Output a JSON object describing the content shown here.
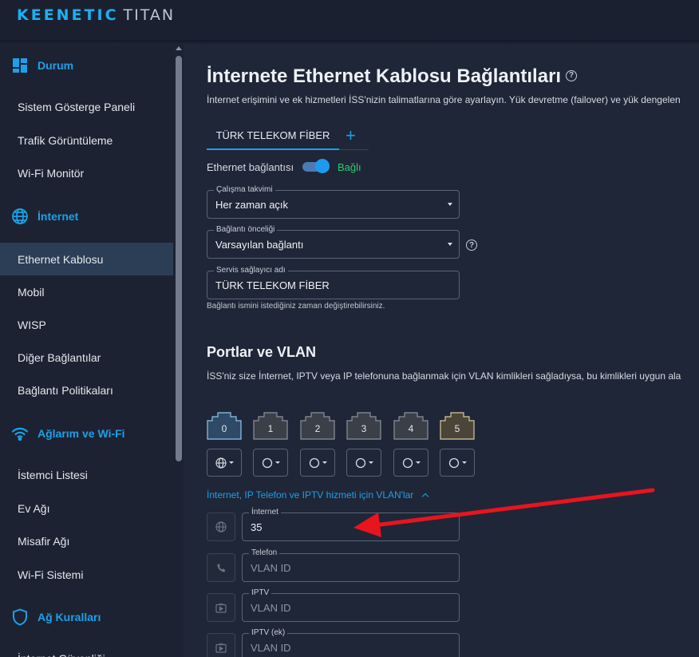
{
  "header": {
    "brand": "KEENETIC",
    "model": "TITAN"
  },
  "sidebar": {
    "sections": [
      {
        "label": "Durum",
        "icon": "dashboard-icon"
      },
      {
        "label": "İnternet",
        "icon": "globe-icon"
      },
      {
        "label": "Ağlarım ve Wi-Fi",
        "icon": "wifi-icon"
      },
      {
        "label": "Ağ Kuralları",
        "icon": "shield-icon"
      }
    ],
    "items": [
      "Sistem Gösterge Paneli",
      "Trafik Görüntüleme",
      "Wi-Fi Monitör",
      "Ethernet Kablosu",
      "Mobil",
      "WISP",
      "Diğer Bağlantılar",
      "Bağlantı Politikaları",
      "İstemci Listesi",
      "Ev Ağı",
      "Misafir Ağı",
      "Wi-Fi Sistemi",
      "İnternet Güvenliği"
    ],
    "active_item": "Ethernet Kablosu"
  },
  "main": {
    "title": "İnternete Ethernet Kablosu Bağlantıları",
    "description": "İnternet erişimini ve ek hizmetleri İSS'nizin talimatlarına göre ayarlayın. Yük devretme (failover) ve yük dengelen",
    "tab": "TÜRK TELEKOM FİBER",
    "toggle": {
      "label": "Ethernet bağlantısı",
      "status": "Bağlı",
      "on": true
    },
    "fields": {
      "schedule": {
        "label": "Çalışma takvimi",
        "value": "Her zaman açık"
      },
      "priority": {
        "label": "Bağlantı önceliği",
        "value": "Varsayılan bağlantı"
      },
      "provider": {
        "label": "Servis sağlayıcı adı",
        "value": "TÜRK TELEKOM FİBER"
      }
    },
    "hint": "Bağlantı ismini istediğiniz zaman değiştirebilirsiniz.",
    "ports_section": {
      "title": "Portlar ve VLAN",
      "description": "İSS'niz size İnternet, IPTV veya IP telefonuna bağlanmak için VLAN kimlikleri sağladıysa, bu kimlikleri uygun ala",
      "ports": [
        "0",
        "1",
        "2",
        "3",
        "4",
        "5"
      ],
      "vlan_toggle": "İnternet, IP Telefon ve IPTV hizmeti için VLAN'lar",
      "vlans": {
        "internet": {
          "label": "İnternet",
          "value": "35",
          "placeholder": "VLAN ID"
        },
        "phone": {
          "label": "Telefon",
          "value": "",
          "placeholder": "VLAN ID"
        },
        "iptv": {
          "label": "IPTV",
          "value": "",
          "placeholder": "VLAN ID"
        },
        "iptv_extra": {
          "label": "IPTV (ek)",
          "value": "",
          "placeholder": "VLAN ID"
        }
      }
    }
  },
  "colors": {
    "accent": "#1da0e8",
    "connected": "#2dcc6e",
    "annotation_arrow": "#e8141e"
  }
}
